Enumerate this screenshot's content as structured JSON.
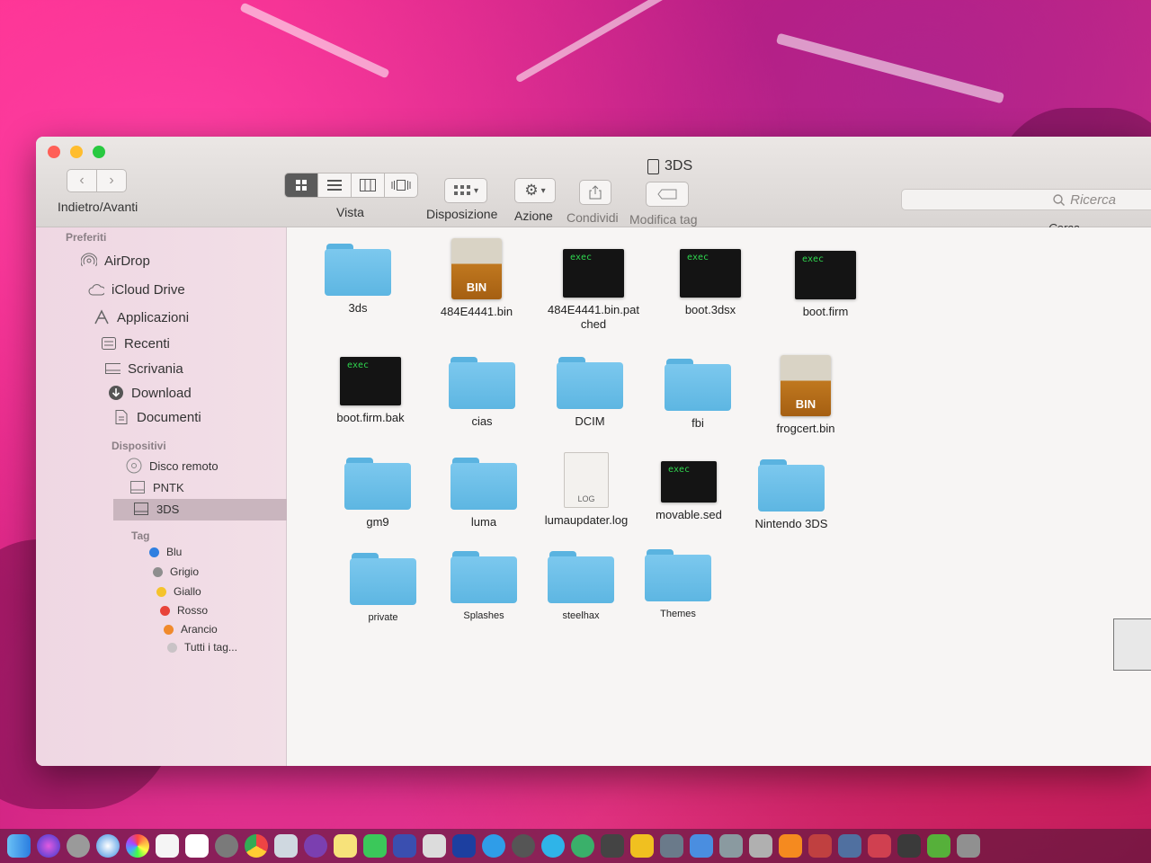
{
  "window": {
    "title": "3DS",
    "nav_label": "Indietro/Avanti",
    "back_glyph": "‹",
    "forward_glyph": "›"
  },
  "toolbar": {
    "view_label": "Vista",
    "arrange_label": "Disposizione",
    "action_label": "Azione",
    "share_label": "Condividi",
    "tag_label": "Modifica tag",
    "search_placeholder": "Ricerca",
    "search_label": "Cerca",
    "icons": [
      "icon-view-icon",
      "list-view-icon",
      "column-view-icon",
      "cover-flow-icon",
      "grid-arrange-icon",
      "gear-icon",
      "share-icon",
      "tag-icon",
      "search-icon"
    ]
  },
  "sidebar": {
    "favorites_heading": "Preferiti",
    "favorites": [
      {
        "label": "AirDrop",
        "icon": "airdrop-icon"
      },
      {
        "label": "iCloud Drive",
        "icon": "cloud-icon"
      },
      {
        "label": "Applicazioni",
        "icon": "applications-icon"
      },
      {
        "label": "Recenti",
        "icon": "recents-icon"
      },
      {
        "label": "Scrivania",
        "icon": "desktop-icon"
      },
      {
        "label": "Download",
        "icon": "download-icon"
      },
      {
        "label": "Documenti",
        "icon": "documents-icon"
      }
    ],
    "devices_heading": "Dispositivi",
    "devices": [
      {
        "label": "Disco remoto",
        "icon": "disc-icon"
      },
      {
        "label": "PNTK",
        "icon": "drive-icon",
        "ejectable": true
      },
      {
        "label": "3DS",
        "icon": "drive-icon",
        "ejectable": true,
        "selected": true
      }
    ],
    "tags_heading": "Tag",
    "tags": [
      {
        "label": "Blu",
        "color": "#2f7fe0"
      },
      {
        "label": "Grigio",
        "color": "#8e8e8e"
      },
      {
        "label": "Giallo",
        "color": "#f5c32c"
      },
      {
        "label": "Rosso",
        "color": "#e8433a"
      },
      {
        "label": "Arancio",
        "color": "#f08a2c"
      },
      {
        "label": "Tutti i tag...",
        "color": "#c9c3c6"
      }
    ]
  },
  "files": [
    {
      "name": "3ds",
      "kind": "folder"
    },
    {
      "name": "484E4441.bin",
      "kind": "bin",
      "badge": "BIN"
    },
    {
      "name": "484E4441.bin.pat ched",
      "kind": "exec",
      "badge": "exec"
    },
    {
      "name": "boot.3dsx",
      "kind": "exec",
      "badge": "exec"
    },
    {
      "name": "boot.firm",
      "kind": "exec",
      "badge": "exec"
    },
    {
      "name": "boot.firm.bak",
      "kind": "exec",
      "badge": "exec"
    },
    {
      "name": "cias",
      "kind": "folder"
    },
    {
      "name": "DCIM",
      "kind": "folder"
    },
    {
      "name": "fbi",
      "kind": "folder"
    },
    {
      "name": "frogcert.bin",
      "kind": "bin",
      "badge": "BIN"
    },
    {
      "name": "gm9",
      "kind": "folder"
    },
    {
      "name": "luma",
      "kind": "folder"
    },
    {
      "name": "lumaupdater.log",
      "kind": "log",
      "badge": "LOG"
    },
    {
      "name": "movable.sed",
      "kind": "exec",
      "badge": "exec"
    },
    {
      "name": "Nintendo 3DS",
      "kind": "folder"
    },
    {
      "name": "private",
      "kind": "folder"
    },
    {
      "name": "Splashes",
      "kind": "folder"
    },
    {
      "name": "steelhax",
      "kind": "folder"
    },
    {
      "name": "Themes",
      "kind": "folder"
    }
  ],
  "colors": {
    "folder": "#6cc0ea",
    "sidebar": "#efd7e3",
    "selection": "#c9b5be",
    "exec_text": "#2fd84f"
  }
}
